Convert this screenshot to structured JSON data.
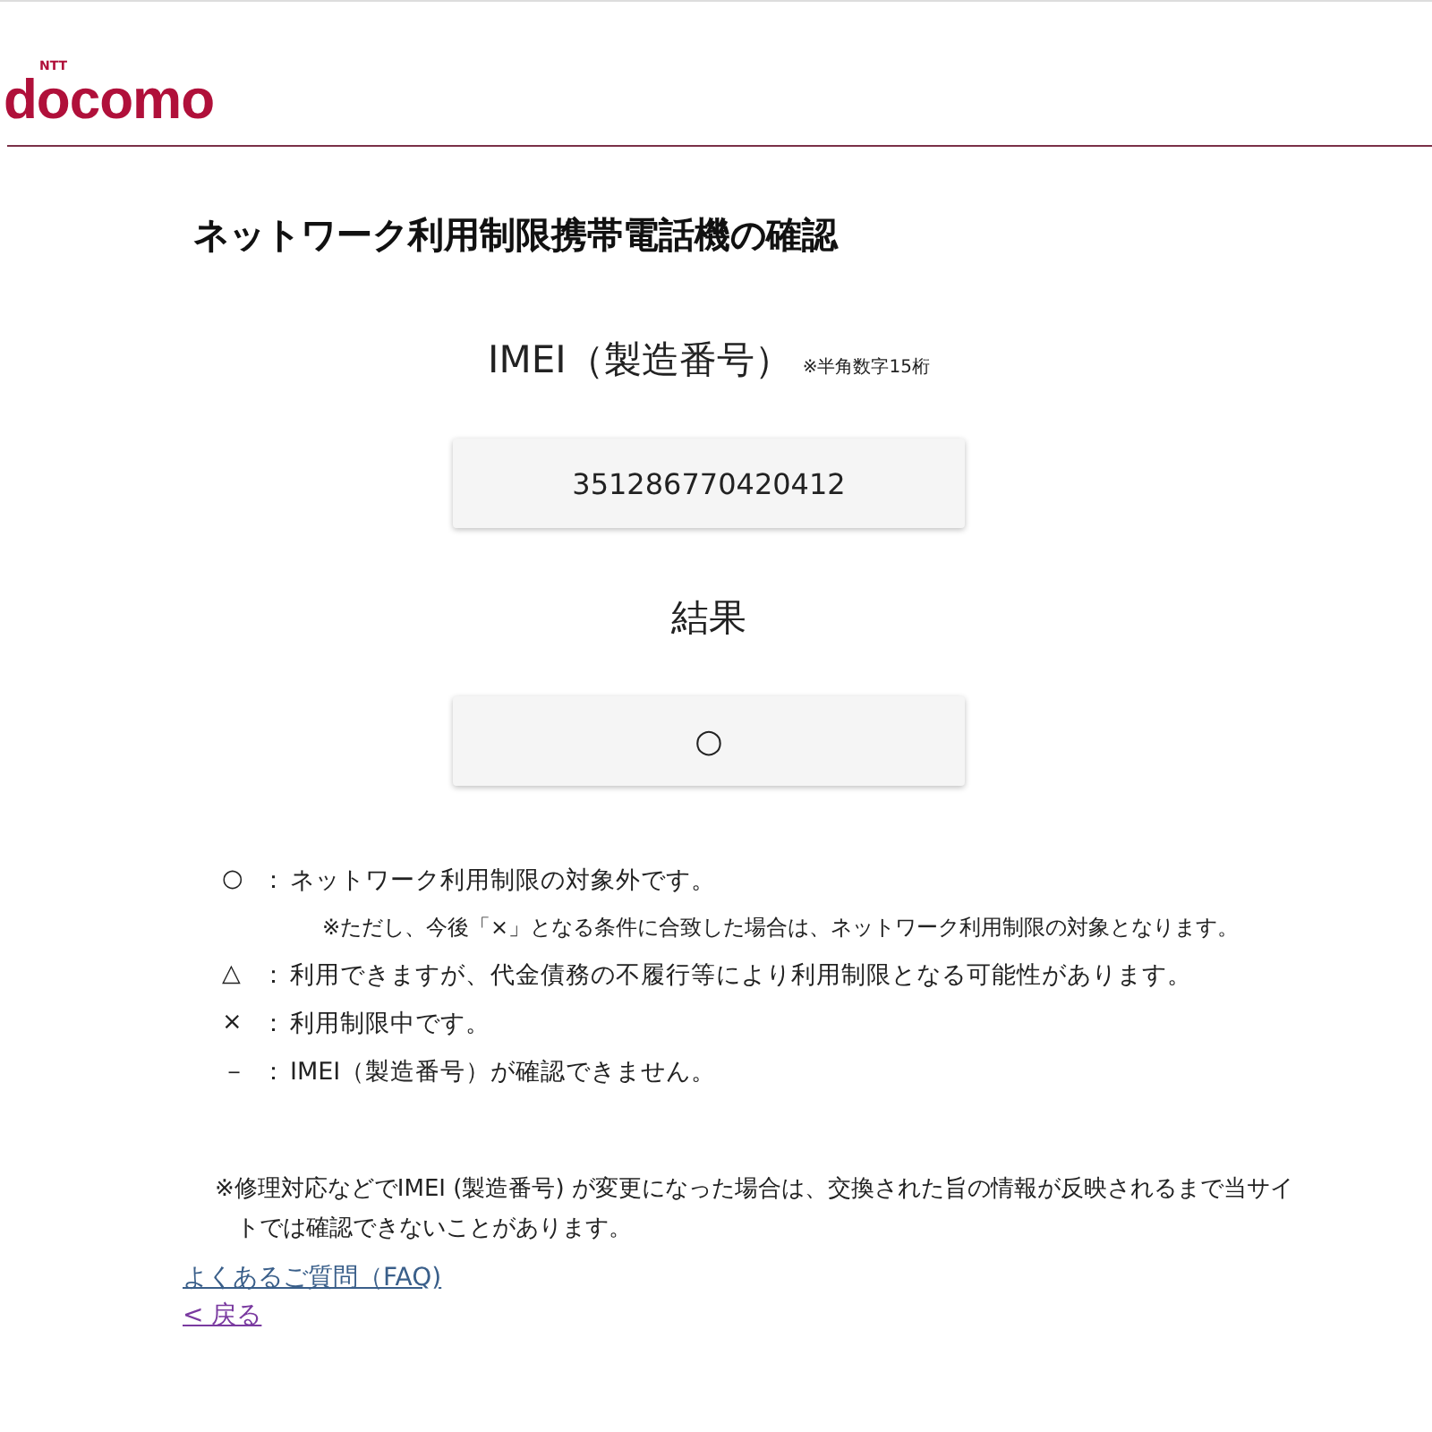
{
  "header": {
    "logo_small": "NTT",
    "logo": "docomo"
  },
  "title": "ネットワーク利用制限携帯電話機の確認",
  "imei": {
    "label": "IMEI（製造番号）",
    "hint": "※半角数字15桁",
    "value": "351286770420412"
  },
  "result": {
    "label": "結果",
    "value": "○"
  },
  "legend": [
    {
      "symbol": "○",
      "separator": "：",
      "text": "ネットワーク利用制限の対象外です。",
      "note": "※ただし、今後「×」となる条件に合致した場合は、ネットワーク利用制限の対象となります。"
    },
    {
      "symbol": "△",
      "separator": "：",
      "text": "利用できますが、代金債務の不履行等により利用制限となる可能性があります。"
    },
    {
      "symbol": "×",
      "separator": "：",
      "text": "利用制限中です。"
    },
    {
      "symbol": "－",
      "separator": "：",
      "text": "IMEI（製造番号）が確認できません。"
    }
  ],
  "note": "※修理対応などでIMEI (製造番号) が変更になった場合は、交換された旨の情報が反映されるまで当サイトでは確認できないことがあります。",
  "links": [
    {
      "label": "よくあるご質問（FAQ)",
      "visited": false
    },
    {
      "label": "< 戻る",
      "visited": true
    }
  ]
}
